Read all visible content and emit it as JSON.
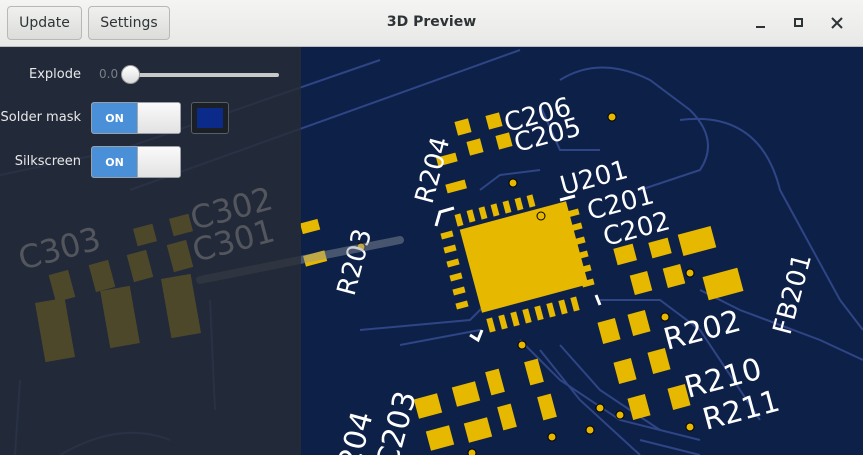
{
  "window": {
    "title": "3D Preview",
    "update_label": "Update",
    "settings_label": "Settings"
  },
  "panel": {
    "explode": {
      "label": "Explode",
      "value": "0.0",
      "level": 0.0
    },
    "solder_mask": {
      "label": "Solder mask",
      "state": "ON",
      "color": "#0b2a8a"
    },
    "silkscreen": {
      "label": "Silkscreen",
      "state": "ON"
    }
  },
  "board": {
    "refs": [
      "C206",
      "C205",
      "R204",
      "U201",
      "C201",
      "C202",
      "R203",
      "C302",
      "C301",
      "C303",
      "R202",
      "FB201",
      "R210",
      "R211",
      "204",
      "C203"
    ],
    "colors": {
      "substrate": "#0d2048",
      "pad": "#e6b800",
      "silk": "#ffffff",
      "trace": "#2a3f7a"
    }
  }
}
